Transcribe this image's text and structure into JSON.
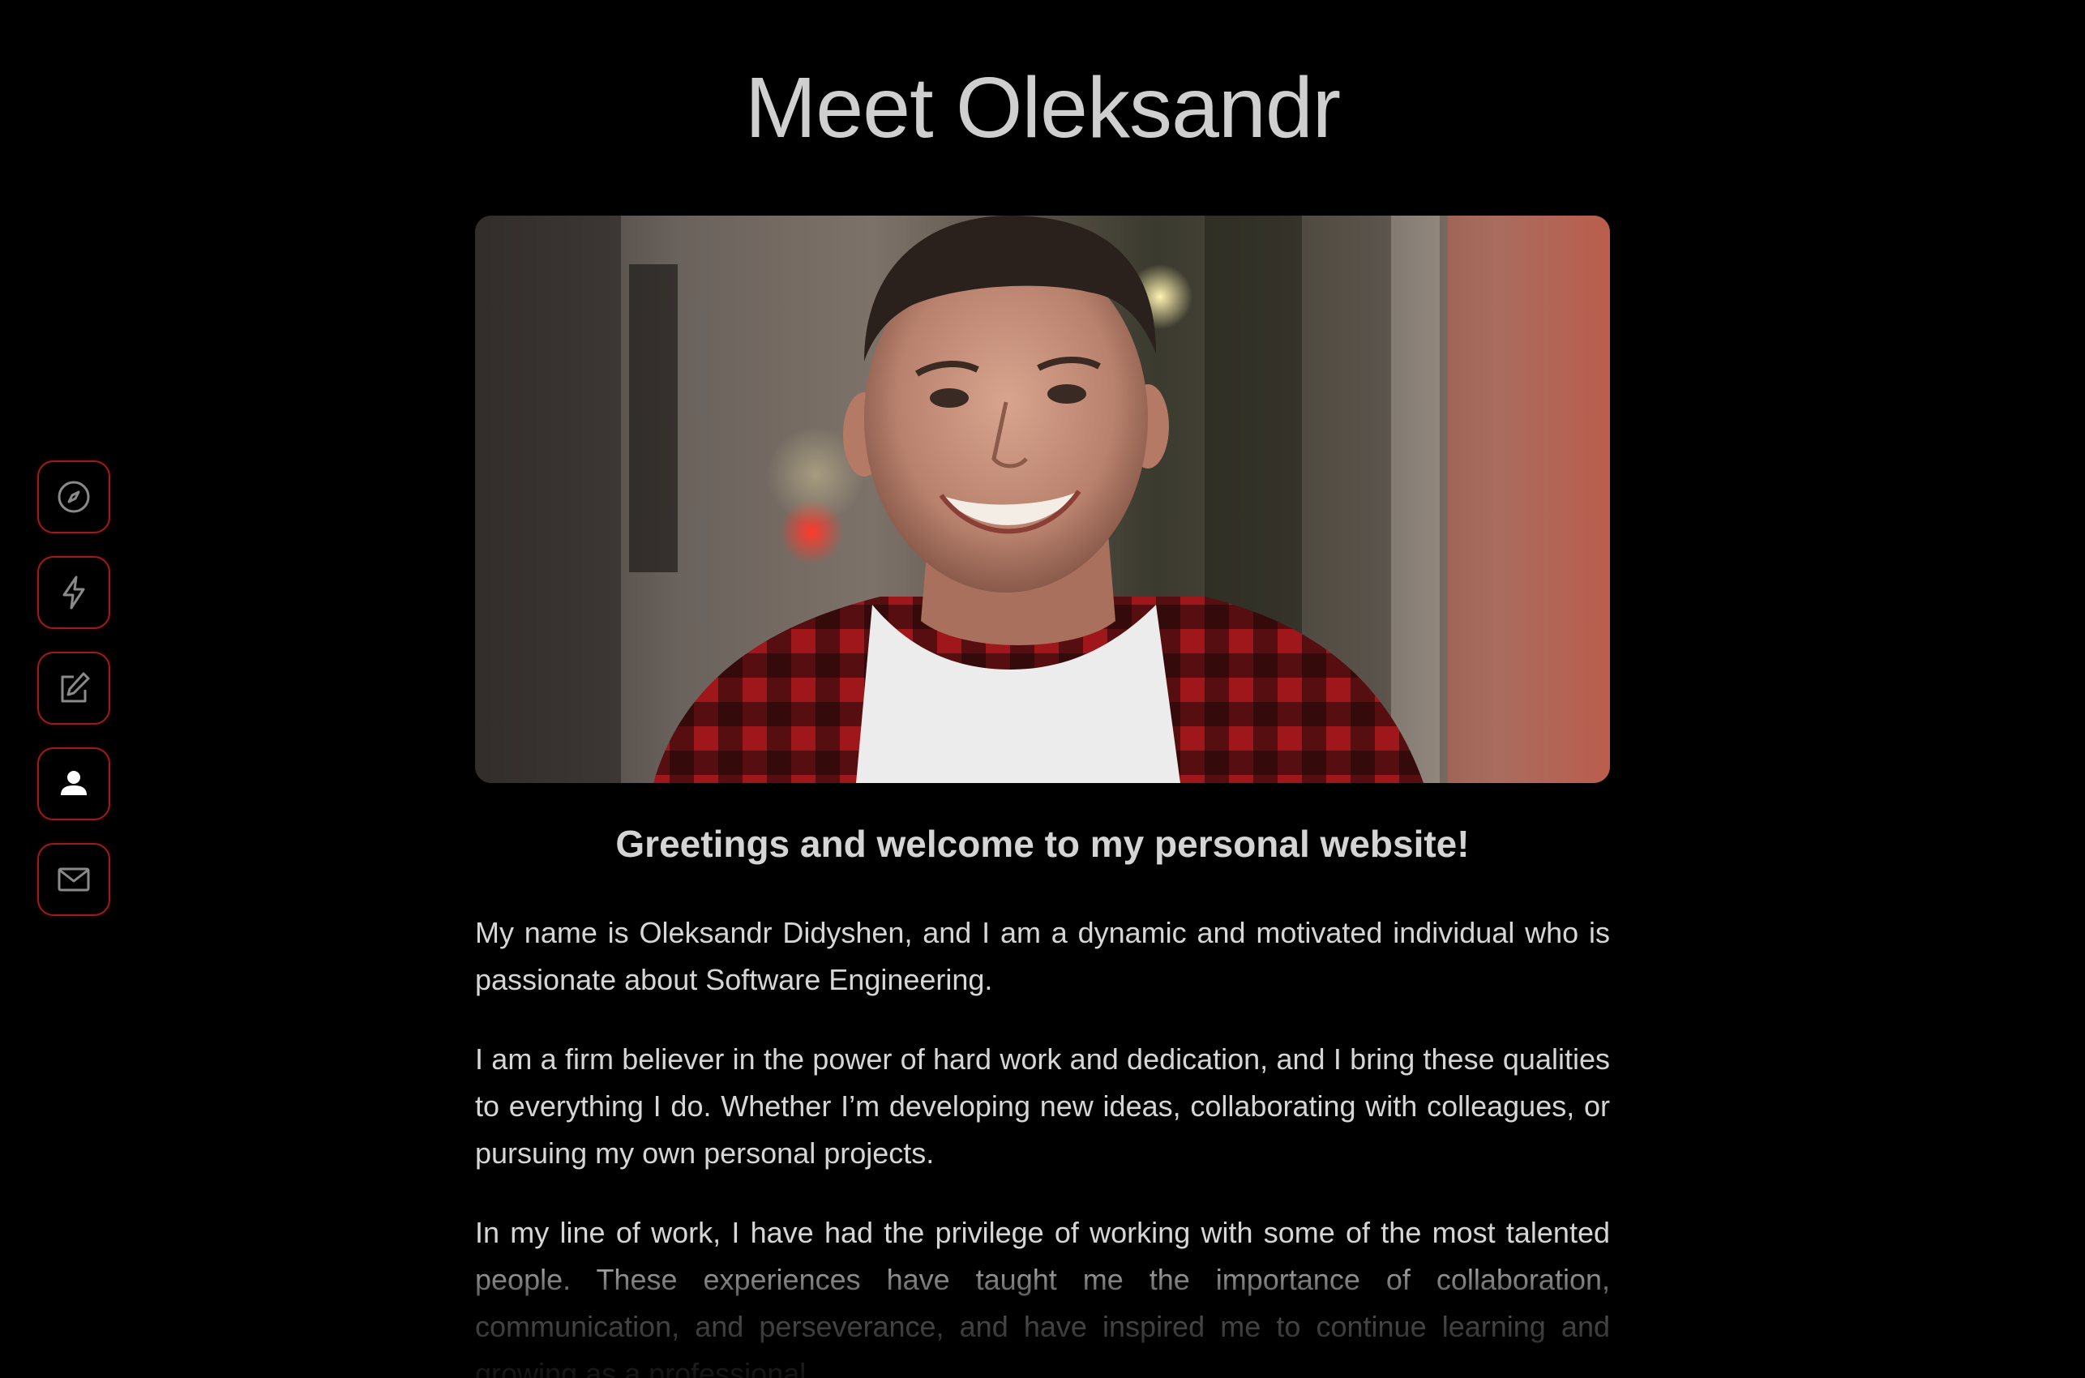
{
  "page": {
    "title": "Meet Oleksandr",
    "photo_alt": "Portrait of Oleksandr smiling",
    "subtitle": "Greetings and welcome to my personal website!",
    "paragraphs": [
      "My name is Oleksandr Didyshen, and I am a dynamic and motivated individual who is passionate about Software Engineering.",
      "I am a firm believer in the power of hard work and dedication, and I bring these qualities to everything I do. Whether I’m developing new ideas, collaborating with colleagues, or pursuing my own personal projects.",
      "In my line of work, I have had the privilege of working with some of the most talented people. These experiences have taught me the importance of collaboration, communication, and perseverance, and have inspired me to continue learning and growing as a professional."
    ]
  },
  "sidebar": {
    "items": [
      {
        "icon": "compass-icon",
        "active": false
      },
      {
        "icon": "lightning-icon",
        "active": false
      },
      {
        "icon": "edit-icon",
        "active": false
      },
      {
        "icon": "user-icon",
        "active": true
      },
      {
        "icon": "mail-icon",
        "active": false
      }
    ]
  },
  "colors": {
    "background": "#000000",
    "accent": "#9c1c1c",
    "text": "#d6d6d6",
    "icon_inactive": "#8a8a8a",
    "icon_active": "#ffffff"
  }
}
